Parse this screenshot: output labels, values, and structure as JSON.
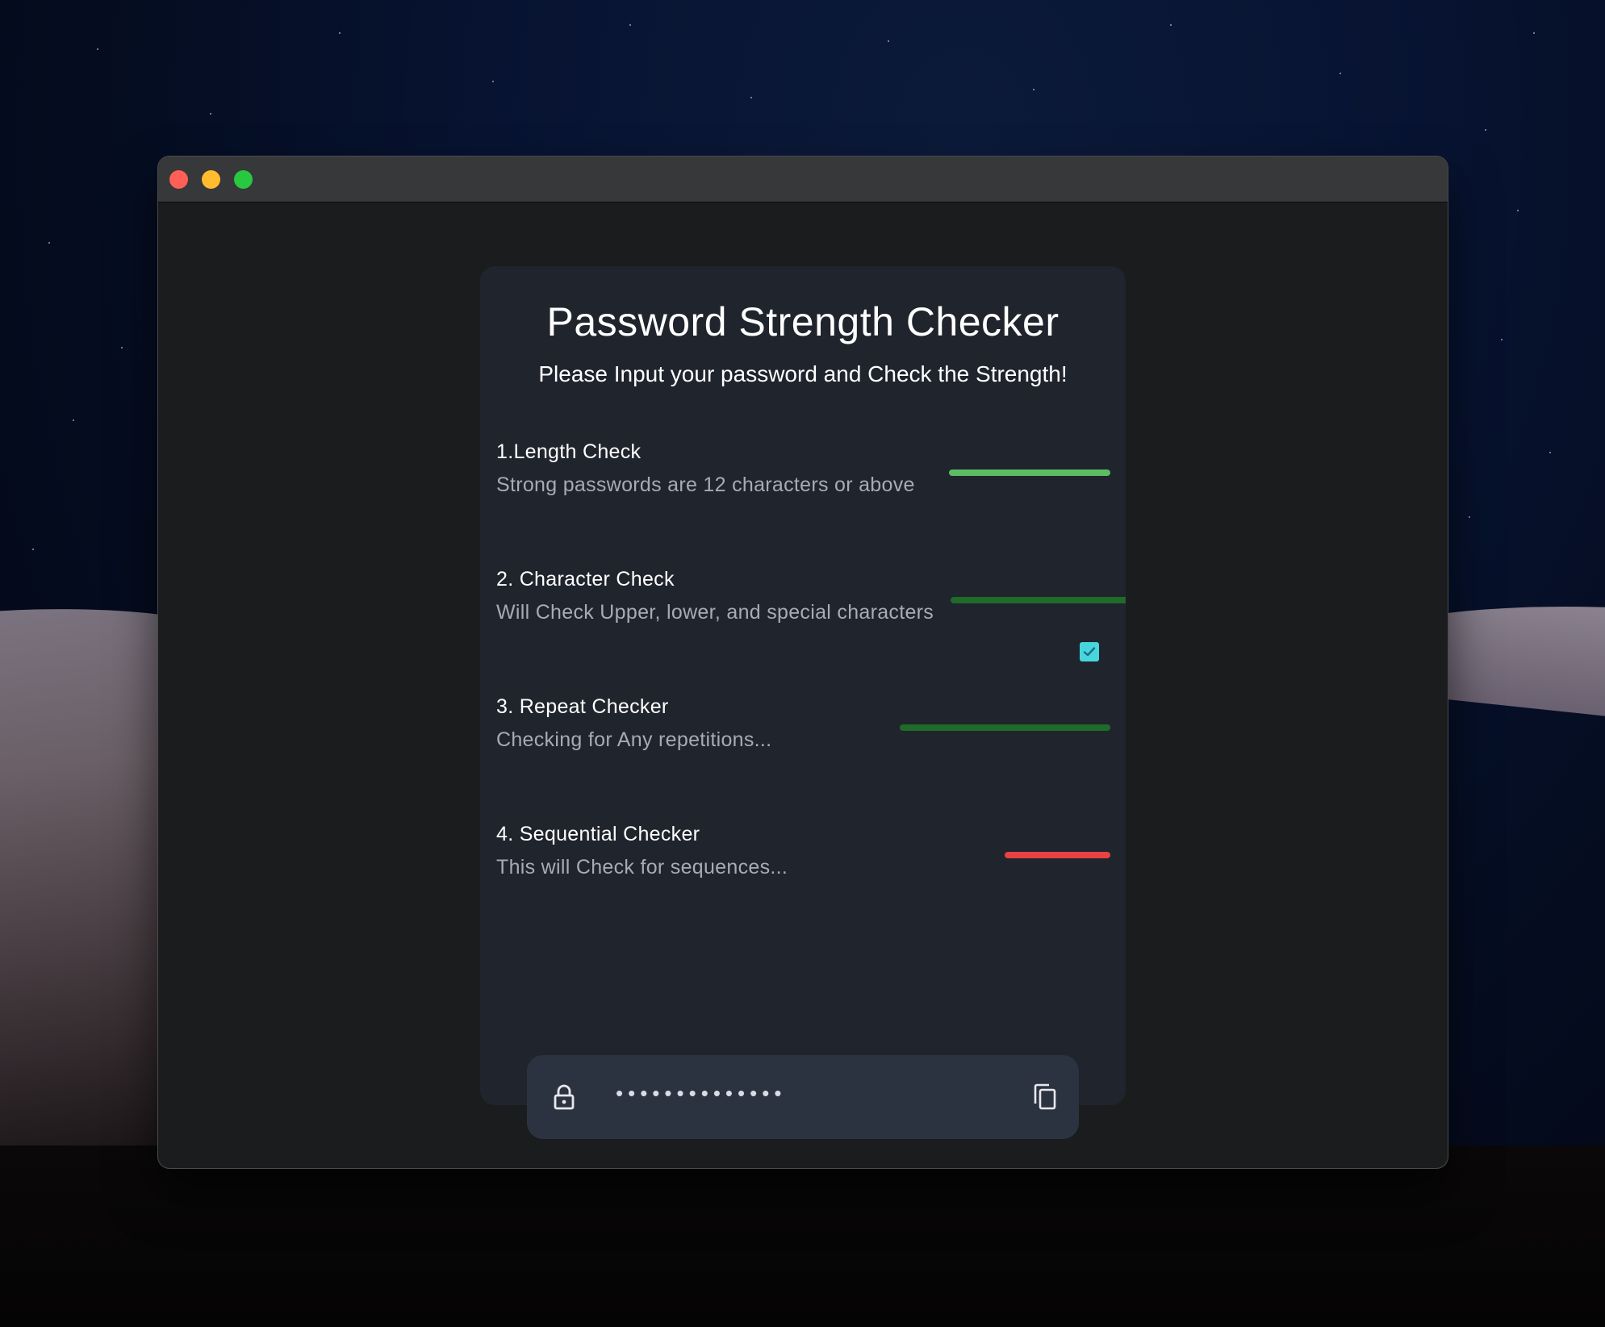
{
  "window": {
    "traffic_lights": {
      "close_color": "#fe5f57",
      "minimize_color": "#febc2e",
      "zoom_color": "#28c840"
    }
  },
  "app": {
    "title": "Password Strength Checker",
    "subtitle": "Please Input your password and Check the Strength!",
    "checks": [
      {
        "title": "1.Length Check",
        "description": "Strong passwords are 12 characters or above",
        "status_color": "#5cbd62"
      },
      {
        "title": "2. Character Check",
        "description": "Will Check Upper, lower, and special characters",
        "status_color": "#1f6b2a",
        "checked": true,
        "checkbox_color": "#48d6de"
      },
      {
        "title": "3. Repeat Checker",
        "description": "Checking for Any repetitions...",
        "status_color": "#1f6b2a"
      },
      {
        "title": "4. Sequential Checker",
        "description": "This will Check for sequences...",
        "status_color": "#e94242"
      }
    ],
    "password_field": {
      "masked_value": "••••••••••••••",
      "lock_icon": "lock-icon",
      "copy_icon": "copy-icon"
    }
  },
  "colors": {
    "window_bg": "#1b1c1e",
    "card_bg": "#20242d",
    "input_bg": "#2c3340"
  }
}
